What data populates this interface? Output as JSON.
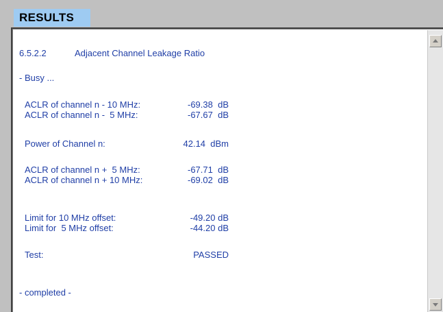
{
  "header": {
    "title": "RESULTS"
  },
  "results": {
    "test_id": "6.5.2.2",
    "test_name": "Adjacent Channel Leakage Ratio",
    "status_busy": "- Busy ...",
    "aclr_minus_10_label": "ACLR of channel n - 10 MHz:",
    "aclr_minus_10_value": "-69.38  dB",
    "aclr_minus_5_label": "ACLR of channel n -  5 MHz:",
    "aclr_minus_5_value": "-67.67  dB",
    "power_label": "Power of Channel n:",
    "power_value": "42.14  dBm",
    "aclr_plus_5_label": "ACLR of channel n +  5 MHz:",
    "aclr_plus_5_value": "-67.71  dB",
    "aclr_plus_10_label": "ACLR of channel n + 10 MHz:",
    "aclr_plus_10_value": "-69.02  dB",
    "limit_10_label": "Limit for 10 MHz offset:",
    "limit_10_value": "-49.20 dB",
    "limit_5_label": "Limit for  5 MHz offset:",
    "limit_5_value": "-44.20 dB",
    "test_label": "Test:",
    "test_value": "PASSED",
    "status_completed": "- completed -"
  },
  "colors": {
    "text": "#1f3ea6",
    "tab": "#9ecbf2",
    "background": "#c0c0c0"
  },
  "icons": {
    "scroll_up": "scroll-up-arrow-icon",
    "scroll_down": "scroll-down-arrow-icon"
  }
}
